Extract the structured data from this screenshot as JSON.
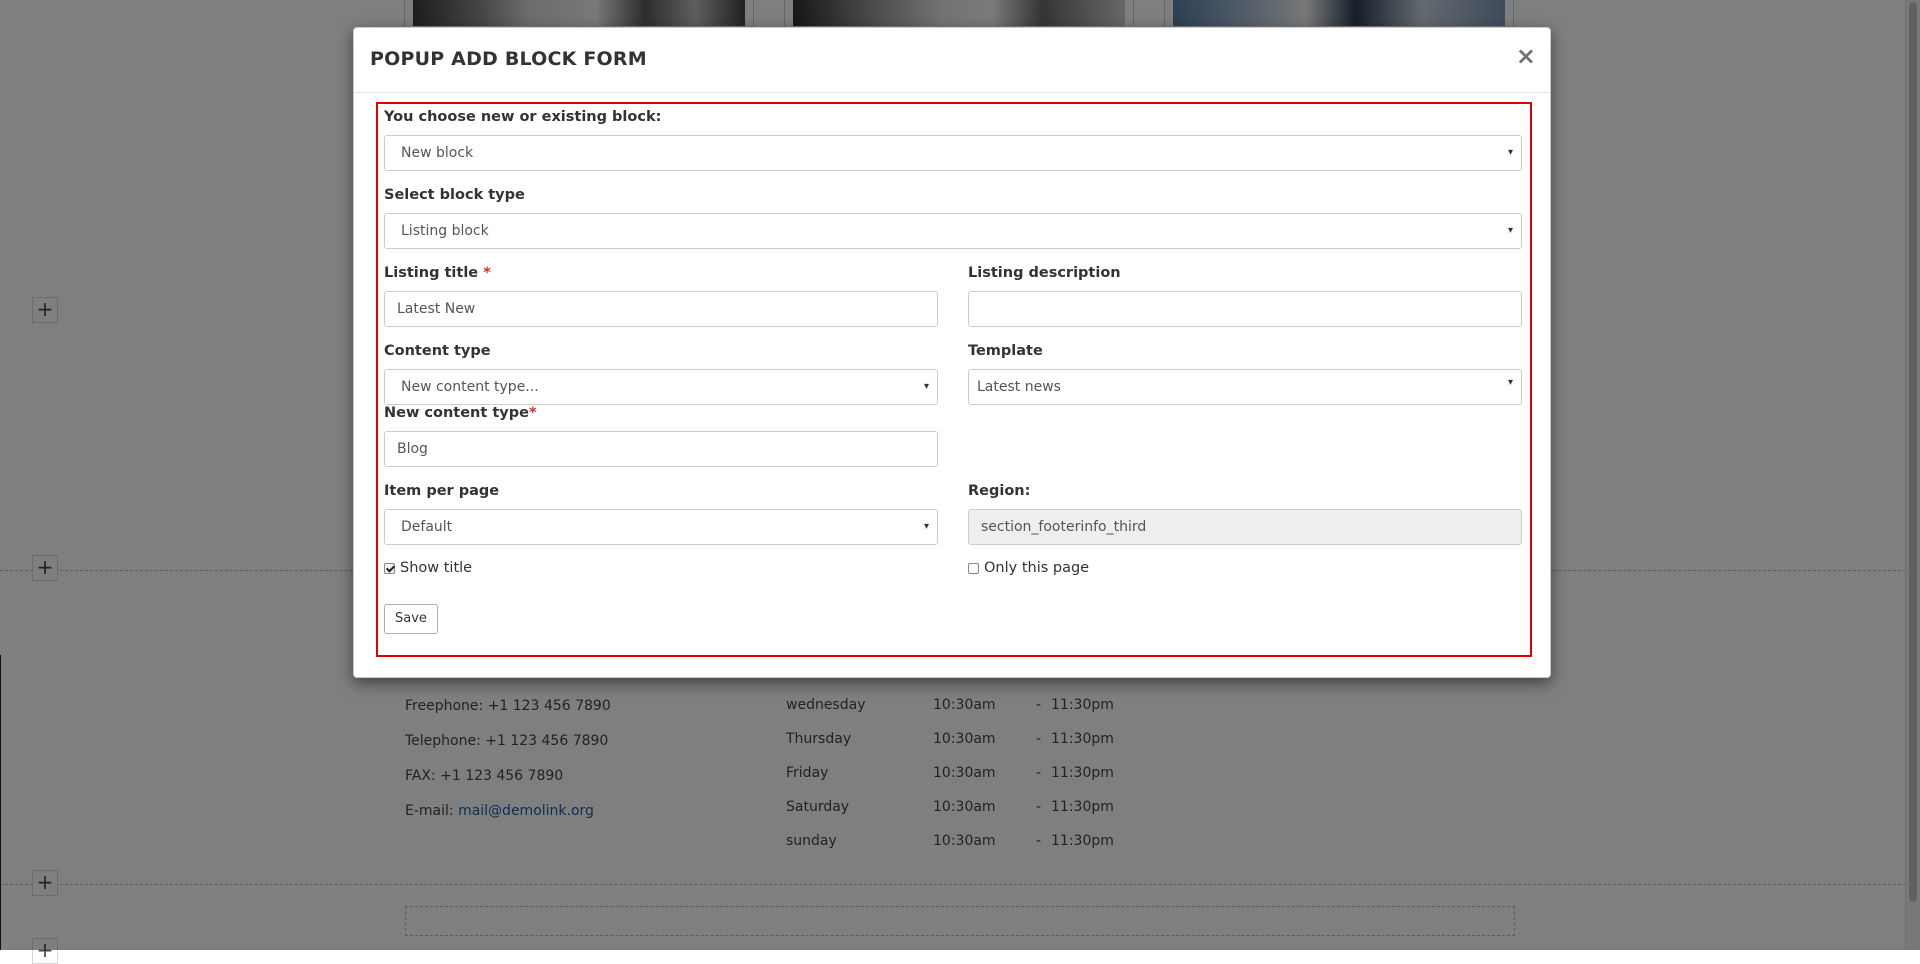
{
  "background": {
    "add_symbol": "+",
    "contact": {
      "freephone": "Freephone: +1 123 456 7890",
      "telephone": "Telephone: +1 123 456 7890",
      "fax": "FAX: +1 123 456 7890",
      "email_label": "E-mail: ",
      "email_link": "mail@demolink.org"
    },
    "hours": [
      {
        "day": "wednesday",
        "open": "10:30am",
        "sep": "-",
        "close": "11:30pm"
      },
      {
        "day": "Thursday",
        "open": "10:30am",
        "sep": "-",
        "close": "11:30pm"
      },
      {
        "day": "Friday",
        "open": "10:30am",
        "sep": "-",
        "close": "11:30pm"
      },
      {
        "day": "Saturday",
        "open": "10:30am",
        "sep": "-",
        "close": "11:30pm"
      },
      {
        "day": "sunday",
        "open": "10:30am",
        "sep": "-",
        "close": "11:30pm"
      }
    ]
  },
  "modal": {
    "title": "POPUP ADD BLOCK FORM",
    "close_symbol": "×",
    "form": {
      "choose_label": "You choose new or existing block:",
      "choose_value": "New block",
      "block_type_label": "Select block type",
      "block_type_value": "Listing block",
      "listing_title_label": "Listing title",
      "required_mark": "*",
      "listing_title_value": "Latest New",
      "listing_description_label": "Listing description",
      "listing_description_value": "",
      "content_type_label": "Content type",
      "content_type_value": "New content type...",
      "template_label": "Template",
      "template_value": "Latest news",
      "new_content_type_label": "New content type",
      "new_content_type_value": "Blog",
      "item_per_page_label": "Item per page",
      "item_per_page_value": "Default",
      "region_label": "Region:",
      "region_value": "section_footerinfo_third",
      "show_title_label": "Show title",
      "show_title_checked": true,
      "only_this_page_label": "Only this page",
      "only_this_page_checked": false,
      "save_label": "Save",
      "caret": "▾"
    }
  },
  "colors": {
    "highlight_border": "#e00000",
    "required": "#c9302c",
    "link": "#1a5fa8"
  }
}
